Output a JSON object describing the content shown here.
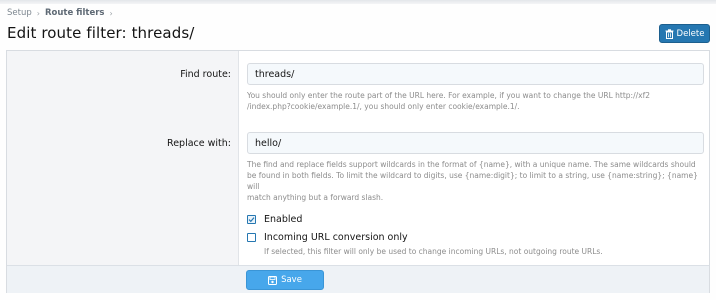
{
  "breadcrumb": {
    "items": [
      "Setup",
      "Route filters"
    ],
    "separator": "›"
  },
  "page": {
    "title": "Edit route filter: threads/"
  },
  "actions": {
    "delete_label": "Delete",
    "delete_icon": "trash-icon",
    "save_label": "Save",
    "save_icon": "save-icon"
  },
  "form": {
    "find_route": {
      "label": "Find route:",
      "value": "threads/",
      "explain_line1": "You should only enter the route part of the URL here. For example, if you want to change the URL http://xf2",
      "explain_line2": "/index.php?cookie/example.1/, you should only enter cookie/example.1/."
    },
    "replace_with": {
      "label": "Replace with:",
      "value": "hello/",
      "explain_line1": "The find and replace fields support wildcards in the format of {name}, with a unique name. The same wildcards should",
      "explain_line2": "be found in both fields. To limit the wildcard to digits, use {name:digit}; to limit to a string, use {name:string}; {name} will",
      "explain_line3": "match anything but a forward slash."
    },
    "enabled": {
      "label": "Enabled",
      "checked": true
    },
    "incoming_only": {
      "label": "Incoming URL conversion only",
      "checked": false,
      "hint": "If selected, this filter will only be used to change incoming URLs, not outgoing route URLs."
    }
  },
  "colors": {
    "primary": "#2577b1",
    "save": "#47a7eb",
    "label_bg": "#f4f5f7"
  }
}
